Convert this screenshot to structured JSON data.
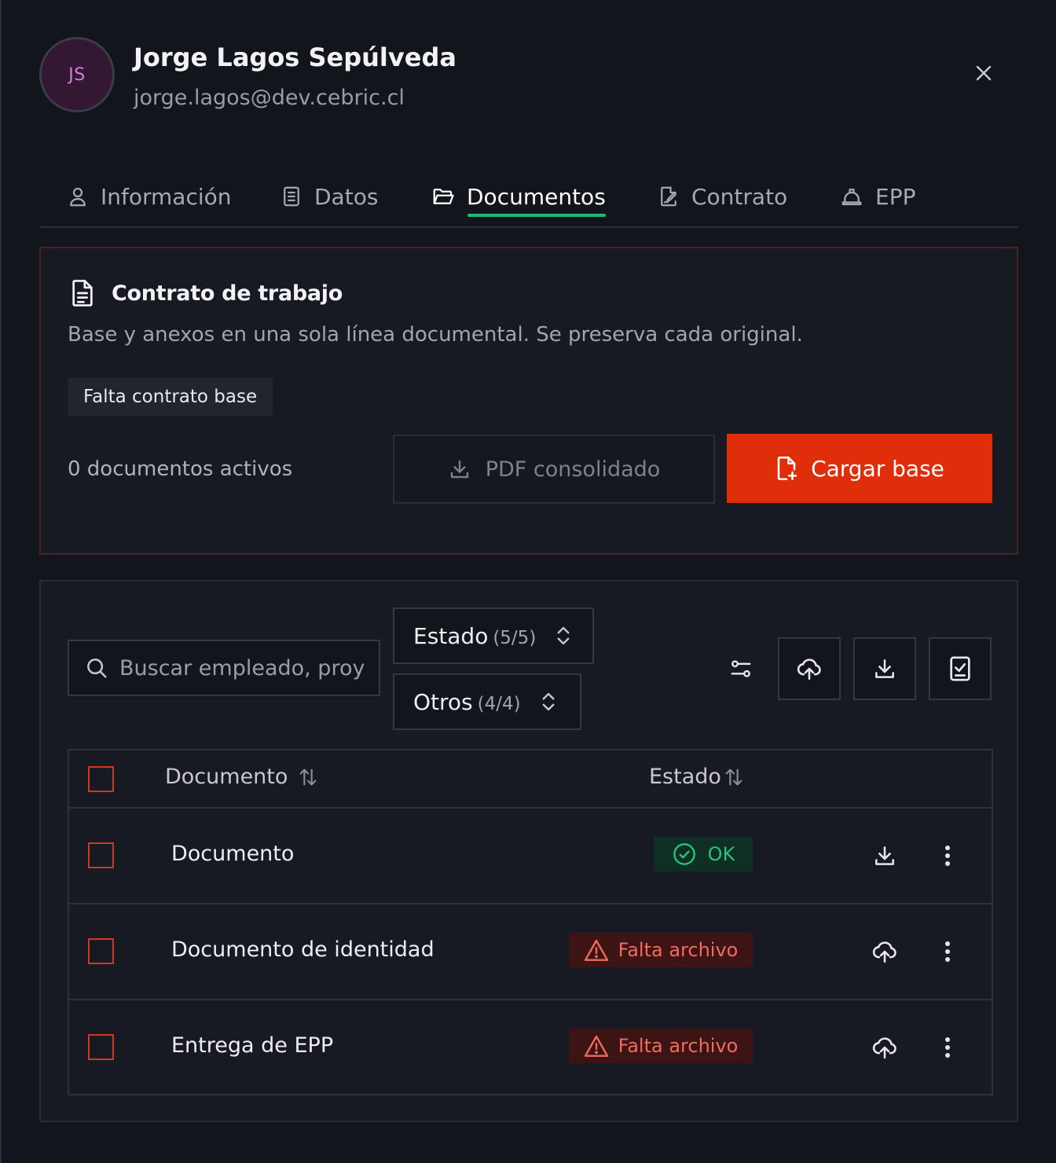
{
  "user": {
    "initials": "JS",
    "name": "Jorge Lagos Sepúlveda",
    "email": "jorge.lagos@dev.cebric.cl"
  },
  "tabs": [
    {
      "label": "Información",
      "icon": "user-icon",
      "active": false
    },
    {
      "label": "Datos",
      "icon": "clipboard-icon",
      "active": false
    },
    {
      "label": "Documentos",
      "icon": "folder-icon",
      "active": true
    },
    {
      "label": "Contrato",
      "icon": "file-signature-icon",
      "active": false
    },
    {
      "label": "EPP",
      "icon": "hard-hat-icon",
      "active": false
    }
  ],
  "contract": {
    "title": "Contrato de trabajo",
    "description": "Base y anexos en una sola línea documental. Se preserva cada original.",
    "badge": "Falta contrato base",
    "active_count": "0 documentos activos",
    "pdf_button": "PDF consolidado",
    "upload_button": "Cargar base"
  },
  "filters": {
    "search_placeholder": "Buscar empleado, proy",
    "estado_label": "Estado",
    "estado_count": "(5/5)",
    "otros_label": "Otros",
    "otros_count": "(4/4)"
  },
  "table": {
    "col_document": "Documento",
    "col_status": "Estado",
    "rows": [
      {
        "name": "Documento",
        "status": "OK",
        "status_type": "ok",
        "action": "download-icon"
      },
      {
        "name": "Documento de identidad",
        "status": "Falta archivo",
        "status_type": "missing",
        "action": "upload-cloud-icon"
      },
      {
        "name": "Entrega de EPP",
        "status": "Falta archivo",
        "status_type": "missing",
        "action": "upload-cloud-icon"
      }
    ]
  },
  "colors": {
    "accent_green": "#1fb77a",
    "primary_red": "#e02e0a",
    "ok_text": "#27c27f",
    "missing_text": "#f06b5e",
    "background": "#13151d"
  }
}
